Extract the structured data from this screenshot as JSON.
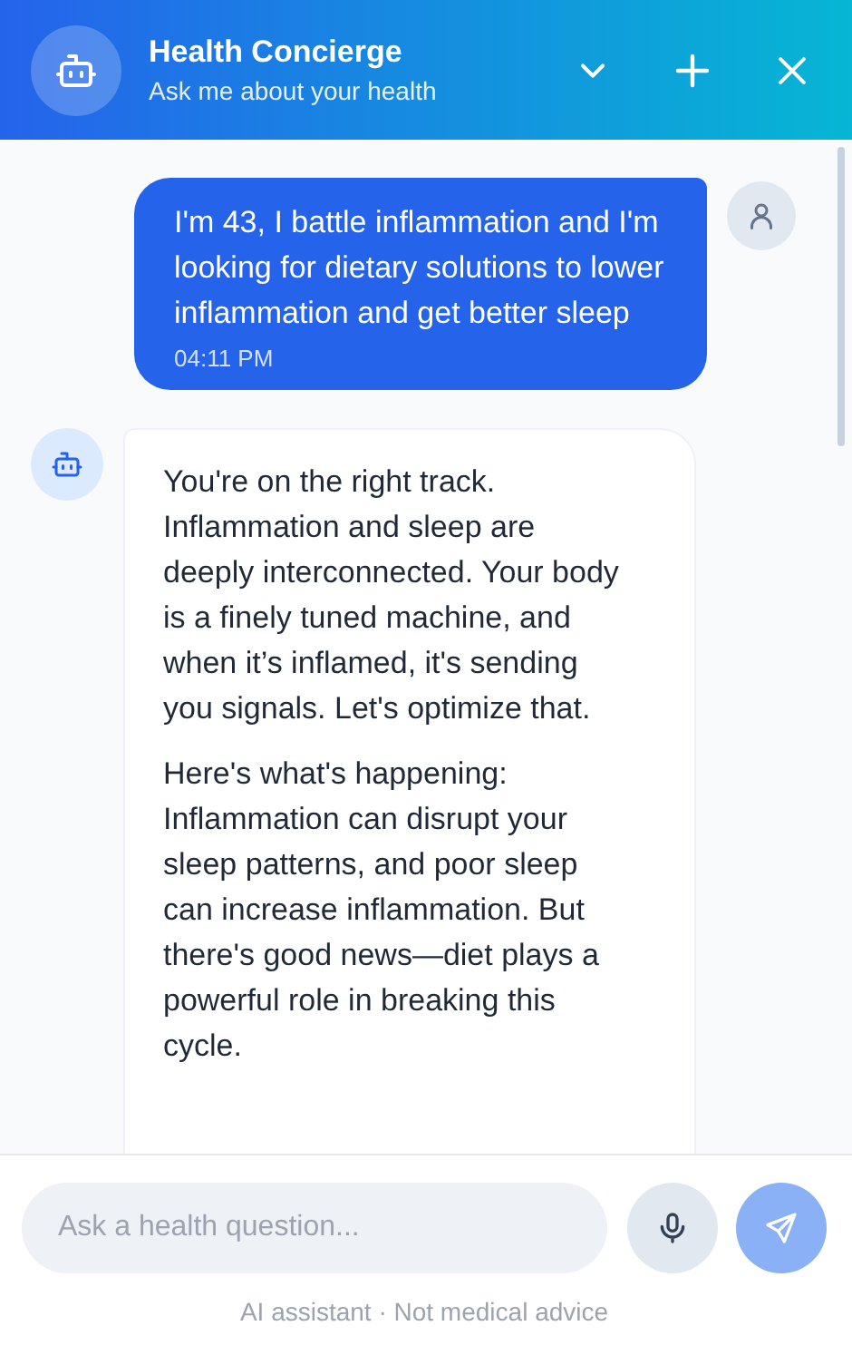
{
  "header": {
    "title": "Health Concierge",
    "subtitle": "Ask me about your health"
  },
  "messages": [
    {
      "kind": "user",
      "paragraphs": [
        "I'm 43, I battle inflammation and I'm looking for dietary solutions to lower inflammation and get better sleep"
      ],
      "time": "04:11 PM"
    },
    {
      "kind": "assistant",
      "paragraphs": [
        "You're on the right track. Inflammation and sleep are deeply interconnected. Your body is a finely tuned machine, and when it’s inflamed, it's sending you signals. Let's optimize that.",
        "Here's what's happening: Inflammation can disrupt your sleep patterns, and poor sleep can increase inflammation. But there's good news—diet plays a powerful role in breaking this cycle."
      ]
    }
  ],
  "composer": {
    "placeholder": "Ask a health question..."
  },
  "footer_note": "AI assistant · Not medical advice"
}
